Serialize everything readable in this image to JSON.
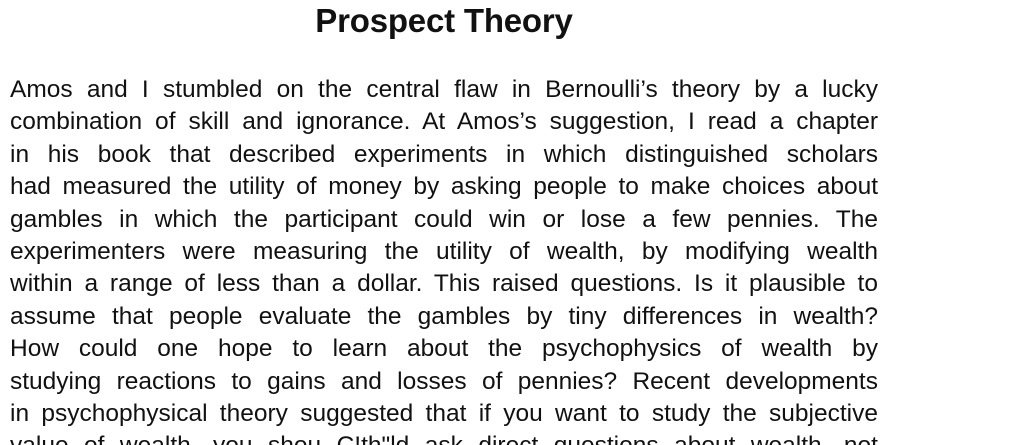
{
  "document": {
    "title": "Prospect Theory",
    "lines": [
      "Amos and I stumbled on the central flaw in Bernoulli’s theory by a lucky",
      "combination of skill and ignorance. At Amos’s suggestion, I read a chapter",
      "in his book that described experiments in which distinguished scholars",
      "had measured the utility of money by asking people to make choices about",
      "gambles in which the participant could win or lose a few pennies. The",
      "experimenters were measuring the utility of wealth, by modifying wealth",
      "within a range of less than a dollar. This raised questions. Is it plausible to",
      "assume that people evaluate the gambles by tiny differences in wealth?",
      "How could one hope to learn about the psychophysics of wealth by",
      "studying reactions to gains and losses of pennies? Recent developments",
      "in psychophysical theory suggested that if you want to study the subjective",
      "value of wealth, you shou C!th\"ld ask direct questions about wealth, not"
    ]
  }
}
